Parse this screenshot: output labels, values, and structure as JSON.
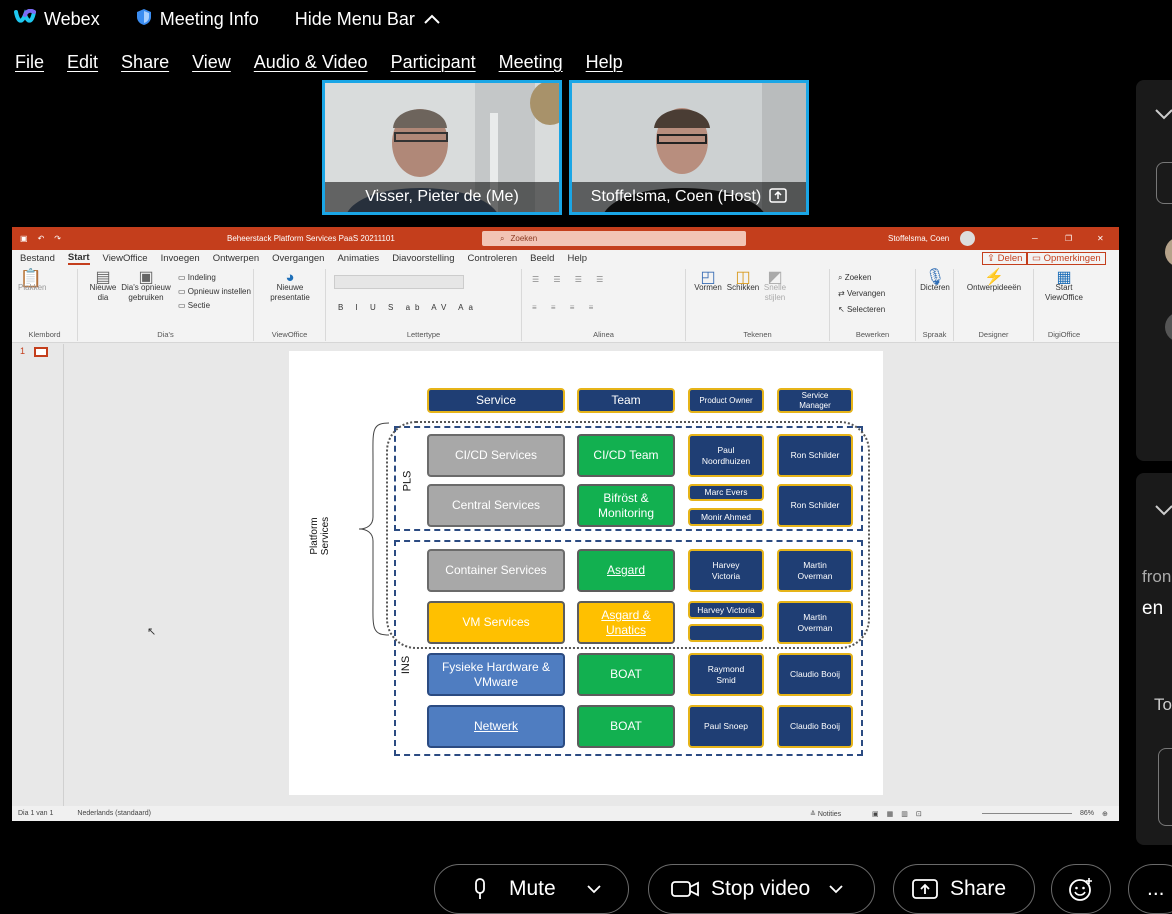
{
  "topbar": {
    "app_name": "Webex",
    "meeting_info": "Meeting Info",
    "hide_menu_bar": "Hide Menu Bar"
  },
  "menu": [
    "File",
    "Edit",
    "Share",
    "View",
    "Audio & Video",
    "Participant",
    "Meeting",
    "Help"
  ],
  "participants": [
    {
      "name": "Visser, Pieter de",
      "tag": "(Me)"
    },
    {
      "name": "Stoffelsma, Coen",
      "tag": "(Host)"
    }
  ],
  "ppt": {
    "doc_title": "Beheerstack Platform Services PaaS 20211101",
    "search_placeholder": "Zoeken",
    "user": "Stoffelsma, Coen",
    "tabs": [
      "Bestand",
      "Start",
      "ViewOffice",
      "Invoegen",
      "Ontwerpen",
      "Overgangen",
      "Animaties",
      "Diavoorstelling",
      "Controleren",
      "Beeld",
      "Help"
    ],
    "share_label": "Delen",
    "comments_label": "Opmerkingen",
    "ribbon": {
      "paste": "Plakken",
      "new_slide": "Nieuwe dia",
      "reuse": "Dia's opnieuw gebruiken",
      "layout": "Indeling",
      "reset": "Opnieuw instellen",
      "section": "Sectie",
      "new_presentation": "Nieuwe presentatie",
      "shapes": "Vormen",
      "arrange": "Schikken",
      "quick_styles": "Snelle stijlen",
      "find": "Zoeken",
      "replace": "Vervangen",
      "select": "Selecteren",
      "dictate": "Dicteren",
      "designer": "Ontwerpideeën",
      "start_viewoffice": "Start ViewOffice",
      "groups": [
        "Klembord",
        "Dia's",
        "ViewOffice",
        "Lettertype",
        "Alinea",
        "Tekenen",
        "Bewerken",
        "Spraak",
        "Designer",
        "DigiOffice"
      ]
    },
    "slide_number": "1",
    "status_left": "Dia 1 van 1",
    "status_lang": "Nederlands (standaard)",
    "status_notes": "Notities",
    "zoom": "86%"
  },
  "slide": {
    "headers": [
      "Service",
      "Team",
      "Product Owner",
      "Service Manager"
    ],
    "group_platform": "Platform Services",
    "group_pls": "PLS",
    "group_ins": "INS",
    "rows": [
      {
        "service": "CI/CD Services",
        "team": "CI/CD Team",
        "owner": "Paul Noordhuizen",
        "manager": "Ron Schilder"
      },
      {
        "service": "Central Services",
        "team": "Bifröst & Monitoring",
        "owner": "Marc Evers",
        "owner2": "Monir Ahmed",
        "manager": "Ron Schilder"
      },
      {
        "service": "Container Services",
        "team": "Asgard",
        "owner": "Harvey Victoria",
        "manager": "Martin Overman"
      },
      {
        "service": "VM Services",
        "team": "Asgard & Unatics",
        "owner": "Harvey Victoria",
        "owner2": "",
        "manager": "Martin Overman"
      },
      {
        "service": "Fysieke Hardware & VMware",
        "team": "BOAT",
        "owner": "Raymond Smid",
        "manager": "Claudio Booij"
      },
      {
        "service": "Netwerk",
        "team": "BOAT",
        "owner": "Paul Snoep",
        "manager": "Claudio Booij"
      }
    ]
  },
  "side": {
    "text1": "fron",
    "text2": "en",
    "text3": "To"
  },
  "controls": {
    "mute": "Mute",
    "stop_video": "Stop video",
    "share": "Share",
    "more": "..."
  }
}
